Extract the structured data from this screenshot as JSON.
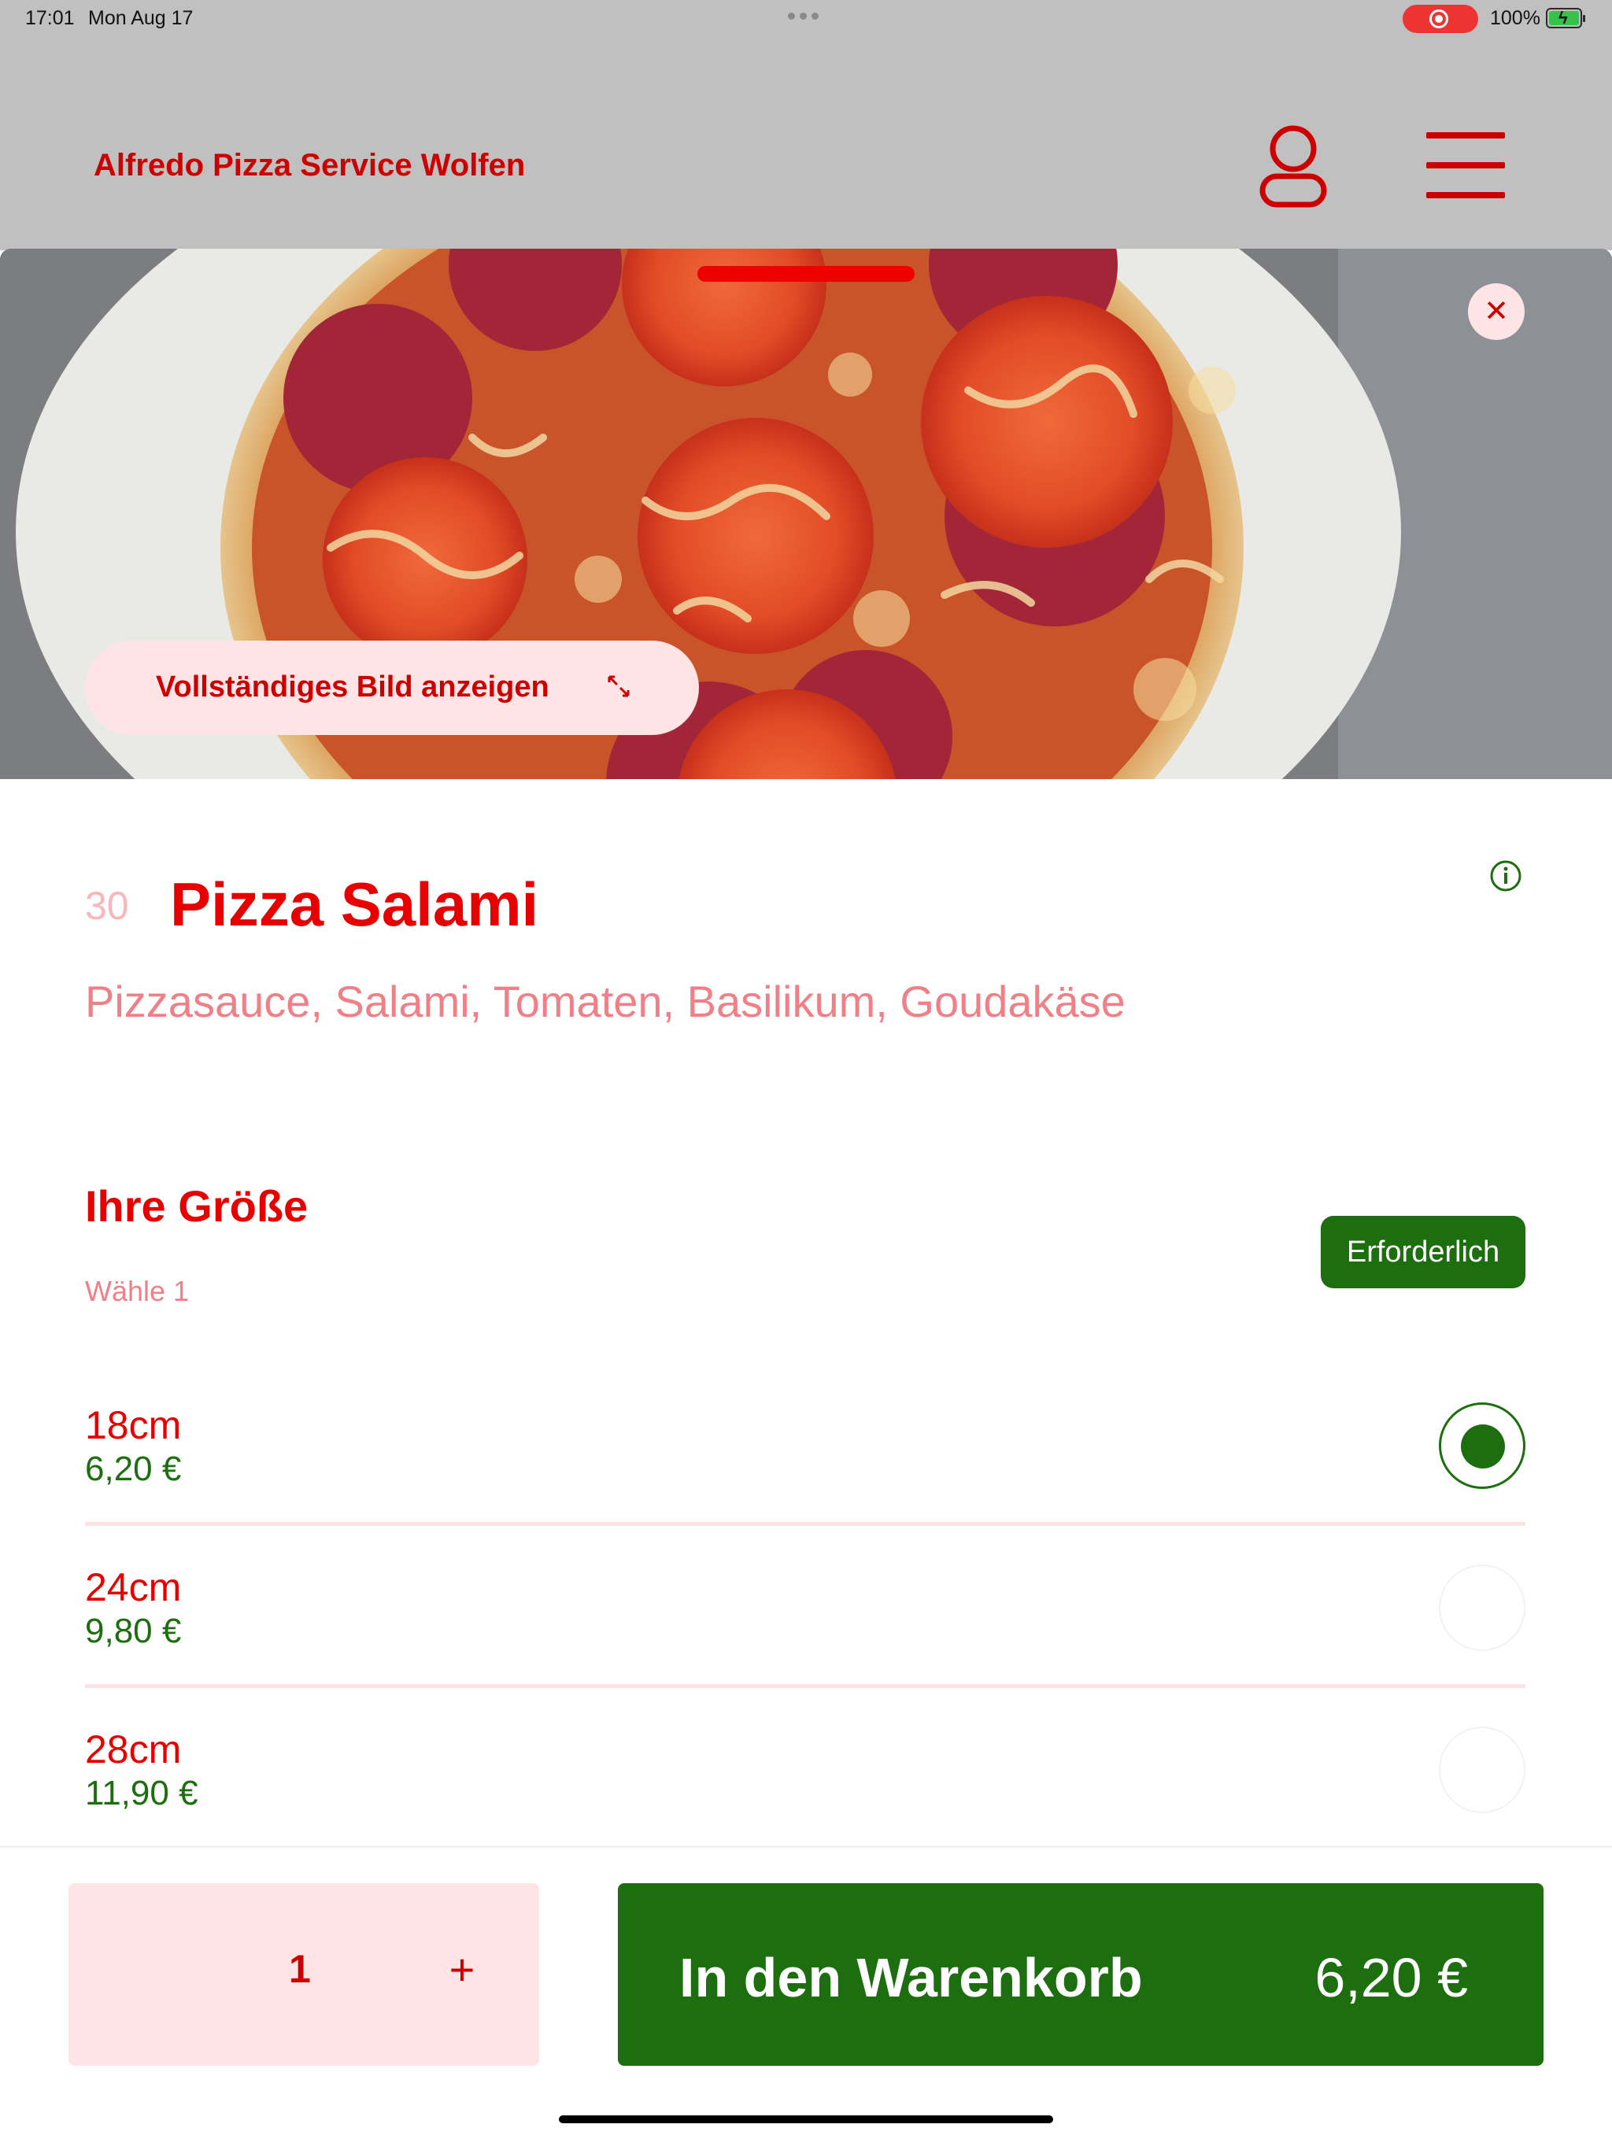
{
  "status_bar": {
    "time": "17:01",
    "date": "Mon Aug 17",
    "battery": "100%"
  },
  "header": {
    "title": "Alfredo Pizza Service Wolfen",
    "account_icon": "account-icon",
    "menu_icon": "hamburger-menu-icon"
  },
  "sheet": {
    "close_icon": "close-icon",
    "full_image_button": "Vollständiges Bild anzeigen",
    "expand_icon": "expand-icon"
  },
  "product": {
    "number": "30",
    "name": "Pizza Salami",
    "description": "Pizzasauce, Salami, Tomaten, Basilikum, Goudakäse",
    "info_icon": "info-icon"
  },
  "size_section": {
    "title": "Ihre Größe",
    "subtitle": "Wähle 1",
    "required_badge": "Erforderlich",
    "options": [
      {
        "label": "18cm",
        "price": "6,20 €",
        "selected": true
      },
      {
        "label": "24cm",
        "price": "9,80 €",
        "selected": false
      },
      {
        "label": "28cm",
        "price": "11,90 €",
        "selected": false
      }
    ]
  },
  "footer": {
    "quantity": "1",
    "plus_label": "+",
    "add_to_cart_label": "In den Warenkorb",
    "total_price": "6,20 €"
  },
  "colors": {
    "brand_red": "#e60000",
    "accent_green": "#1c6e0e",
    "light_pink": "#ffe4e6"
  }
}
